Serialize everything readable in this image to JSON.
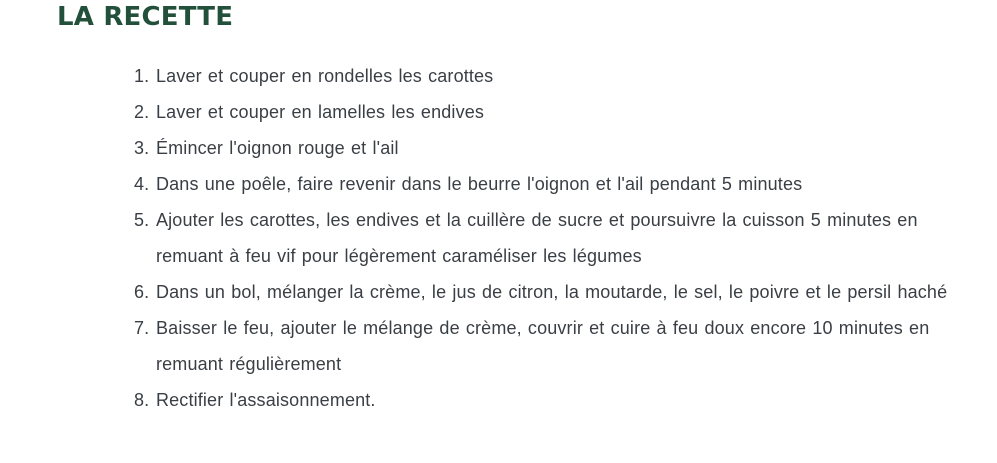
{
  "title": "LA RECETTE",
  "steps": [
    {
      "num": "1.",
      "text": "Laver et couper en rondelles les carottes"
    },
    {
      "num": "2.",
      "text": "Laver et couper en lamelles les endives"
    },
    {
      "num": "3.",
      "text": "Émincer l'oignon rouge et l'ail"
    },
    {
      "num": "4.",
      "text": "Dans une poêle, faire revenir dans le beurre l'oignon et l'ail pendant 5 minutes"
    },
    {
      "num": "5.",
      "text": "Ajouter les carottes, les endives et la cuillère de sucre et poursuivre la cuisson 5 minutes en remuant à feu vif pour légèrement caraméliser les légumes"
    },
    {
      "num": "6.",
      "text": "Dans un bol, mélanger la crème, le jus de citron, la moutarde, le sel, le poivre et le persil haché"
    },
    {
      "num": "7.",
      "text": "Baisser le feu, ajouter le mélange de crème, couvrir et cuire à feu doux encore 10 minutes en remuant régulièrement"
    },
    {
      "num": "8.",
      "text": "Rectifier l'assaisonnement."
    }
  ],
  "colors": {
    "title": "#23503a",
    "text": "#3a3f45",
    "background": "#ffffff"
  }
}
